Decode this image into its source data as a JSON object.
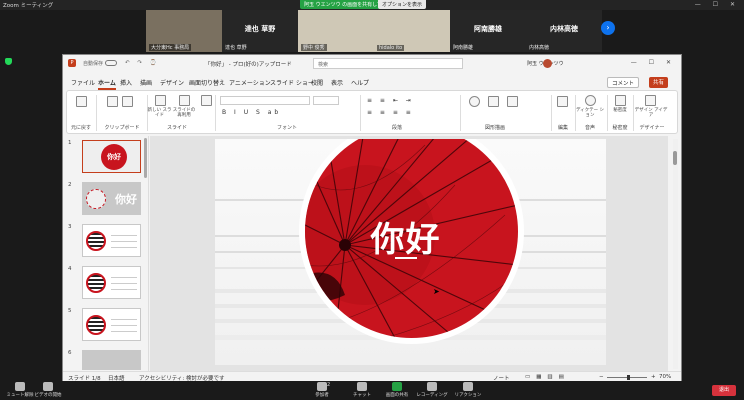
{
  "zoom": {
    "title": "Zoom ミーティング",
    "sharing_banner": "阿玉 ウエンツウ の画面を共有しています",
    "view_options": "オプションを表示",
    "window_controls": "— ☐ ✕"
  },
  "participants": [
    {
      "label": "大分東Hc  事務局",
      "name": ""
    },
    {
      "label": "達也 草野",
      "name": "達也 草野"
    },
    {
      "label": "野中 俊秀",
      "name": ""
    },
    {
      "label": "hidalo ito",
      "name": ""
    },
    {
      "label": "阿南勝雄",
      "name": "阿南勝雄"
    },
    {
      "label": "内林高徳",
      "name": "内林高徳"
    }
  ],
  "ppt": {
    "autosave": "自動保存",
    "qa": "↶ ↷ ⌚",
    "filename": "「你好」 - プロ(好の)アップロード",
    "search": "検索",
    "user": "阿玉 ウエンツウ",
    "window_controls": "— ☐ ✕",
    "menu": [
      "ファイル",
      "ホーム",
      "挿入",
      "描画",
      "デザイン",
      "画面切り替え",
      "アニメーション",
      "スライド ショー",
      "校閲",
      "表示",
      "ヘルプ"
    ],
    "comment": "コメント",
    "share": "共有",
    "ribbon": {
      "undo": "元に戻す",
      "clipboard": "クリップボード",
      "new_slide": "新しい スライド",
      "reuse_slide": "スライドの 再利用",
      "slide": "スライド",
      "font": "フォント",
      "paragraph": "段落",
      "drawing": "図形描画",
      "edit": "編集",
      "dictation": "ディクテー ション",
      "voice": "音声",
      "sensitivity": "秘密度",
      "designer": "デザイン アイデア",
      "designer_group": "デザイナー",
      "sens_label": "秘密度"
    },
    "slide_numbers": [
      "1",
      "2",
      "3",
      "4",
      "5",
      "6"
    ],
    "slide_title": "你好",
    "thumb1_text": "你好",
    "thumb2_text": "你好",
    "status": {
      "slide_pos": "スライド 1/8",
      "lang": "日本語",
      "accessibility": "アクセシビリティ: 検討が必要です",
      "notes": "ノート",
      "zoom": "70%"
    }
  },
  "toolbar": [
    {
      "label": "ミュート解除"
    },
    {
      "label": "ビデオの開始"
    },
    {
      "label": "参加者"
    },
    {
      "label": "チャット"
    },
    {
      "label": "画面の共有"
    },
    {
      "label": "レコーディング"
    },
    {
      "label": "リアクション"
    }
  ],
  "end": "退出",
  "participants_count": "2",
  "colors": {
    "accent": "#c43e1c",
    "slide_red": "#c8141e",
    "zoom_green": "#25a244"
  }
}
